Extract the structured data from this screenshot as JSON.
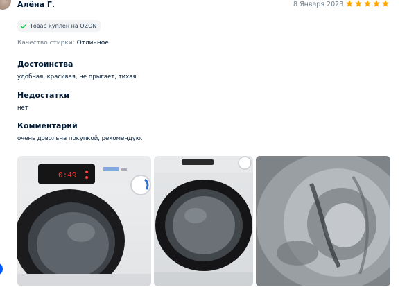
{
  "review": {
    "author": "Алёна Г.",
    "date": "8 Января 2023",
    "rating": 5,
    "rating_max": 5,
    "star_color": "#ffa800",
    "badge": "Товар куплен на OZON",
    "badge_icon": "check-icon",
    "attribute": {
      "label": "Качество стирки:",
      "value": "Отличное"
    },
    "sections": [
      {
        "title": "Достоинства",
        "text": "удобная, красивая, не прыгает, тихая"
      },
      {
        "title": "Недостатки",
        "text": "нет"
      },
      {
        "title": "Комментарий",
        "text": "очень довольна покупкой, рекомендую."
      }
    ],
    "photos": [
      {
        "name": "washing-machine-front-photo",
        "display": "0:49"
      },
      {
        "name": "washing-machine-door-photo"
      },
      {
        "name": "washing-machine-drum-photo"
      }
    ],
    "accent_color": "#005bff"
  }
}
